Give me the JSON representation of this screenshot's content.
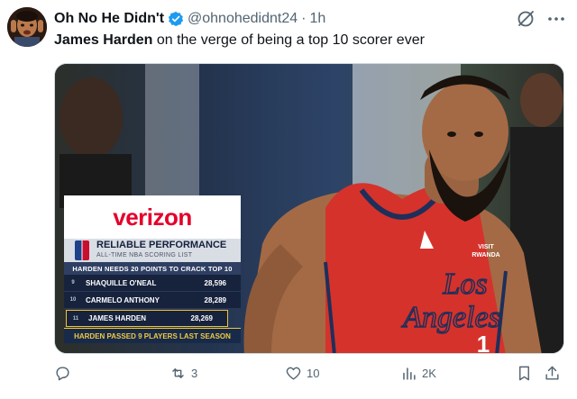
{
  "author": {
    "name": "Oh No He Didn't",
    "handle": "@ohnohedidnt24",
    "separator": "·",
    "time": "1h",
    "verified": true
  },
  "tweet": {
    "text_bold": "James Harden",
    "text_rest": " on the verge of being a top 10 scorer ever"
  },
  "media": {
    "graphic": {
      "brand": "verizon",
      "title": "RELIABLE PERFORMANCE",
      "subtitle": "ALL-TIME NBA SCORING LIST",
      "headline": "HARDEN NEEDS 20 POINTS TO CRACK TOP 10",
      "rows": [
        {
          "rank": "9",
          "name": "SHAQUILLE O'NEAL",
          "points": "28,596"
        },
        {
          "rank": "10",
          "name": "CARMELO ANTHONY",
          "points": "28,289"
        },
        {
          "rank": "11",
          "name": "JAMES HARDEN",
          "points": "28,269"
        }
      ],
      "footer": "HARDEN PASSED 9 PLAYERS LAST SEASON"
    },
    "jersey": {
      "sponsor_line1": "VISIT",
      "sponsor_line2": "RWANDA",
      "script1": "Los",
      "script2": "Angeles",
      "number": "1"
    }
  },
  "actions": {
    "replies": "",
    "reposts": "3",
    "likes": "10",
    "views": "2K"
  },
  "colors": {
    "accent_blue": "#1d9bf0",
    "muted_text": "#536471",
    "verizon_red": "#e4002b",
    "jersey_red": "#d5322c"
  }
}
